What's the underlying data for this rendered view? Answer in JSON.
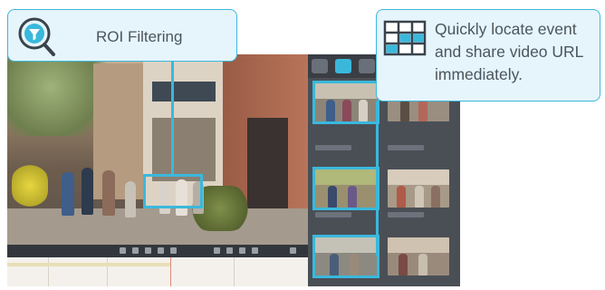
{
  "callouts": {
    "roi": {
      "label": "ROI Filtering",
      "icon": "magnifier-filter-icon"
    },
    "locate": {
      "lines": [
        "Quickly locate event",
        "and share video URL",
        "immediately."
      ],
      "icon": "video-grid-icon"
    }
  },
  "colors": {
    "accent": "#3ab8dc",
    "callout_bg": "#e6f5fb",
    "panel_bg": "#4a4f56",
    "text": "#4a5560"
  }
}
